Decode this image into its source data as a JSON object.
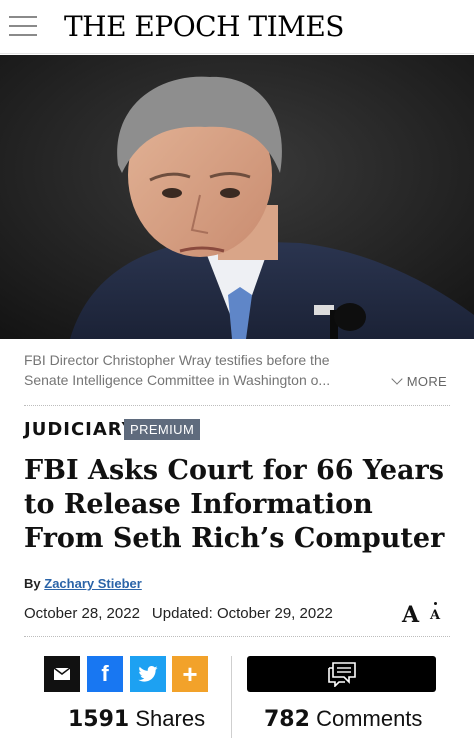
{
  "header": {
    "logo": "THE EPOCH TIMES"
  },
  "hero": {
    "caption": "FBI Director Christopher Wray testifies before the Senate Intelligence Committee in Washington o...",
    "more_label": "MORE"
  },
  "article": {
    "section": "JUDICIARY",
    "badge": "PREMIUM",
    "headline": "FBI Asks Court for 66 Years to Release Information From Seth Rich’s Computer",
    "by_label": "By",
    "author": "Zachary Stieber",
    "published": "October 28, 2022",
    "updated": "Updated: October 29, 2022",
    "font_size_label_big": "A",
    "font_size_label_small": "A"
  },
  "social": {
    "shares_count": "1591",
    "shares_label": "Shares",
    "comments_count": "782",
    "comments_label": "Comments",
    "facebook_glyph": "f",
    "plus_glyph": "+",
    "icons": [
      "email-icon",
      "facebook-icon",
      "twitter-icon",
      "plus-icon",
      "comments-icon"
    ],
    "colors": {
      "facebook": "#1877f2",
      "twitter": "#1da1f2",
      "plus": "#f2a22a",
      "badge": "#5f6b7d",
      "author_link": "#2b64a8"
    }
  }
}
